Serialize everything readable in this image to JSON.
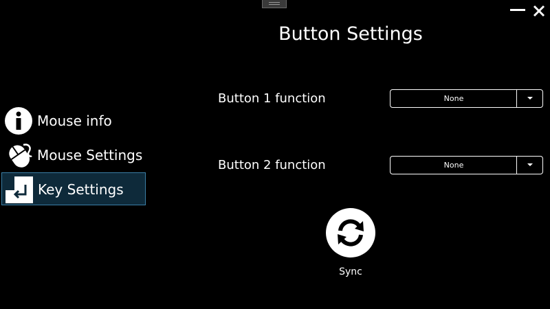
{
  "window": {
    "minimize_icon": "minimize-icon",
    "close_icon": "close-icon",
    "drag_handle_icon": "drag-handle-icon"
  },
  "page": {
    "title": "Button Settings"
  },
  "sidebar": {
    "items": [
      {
        "label": "Mouse info",
        "icon": "info-icon",
        "active": false
      },
      {
        "label": "Mouse Settings",
        "icon": "mouse-icon",
        "active": false
      },
      {
        "label": "Key Settings",
        "icon": "enter-key-icon",
        "active": true
      }
    ]
  },
  "settings": [
    {
      "label": "Button 1 function",
      "selected": "None"
    },
    {
      "label": "Button 2 function",
      "selected": "None"
    }
  ],
  "sync": {
    "label": "Sync",
    "icon": "sync-icon"
  },
  "colors": {
    "background": "#000000",
    "text": "#ffffff",
    "active_item_bg": "#0e2a3a",
    "active_item_border": "#3b7fa6"
  }
}
